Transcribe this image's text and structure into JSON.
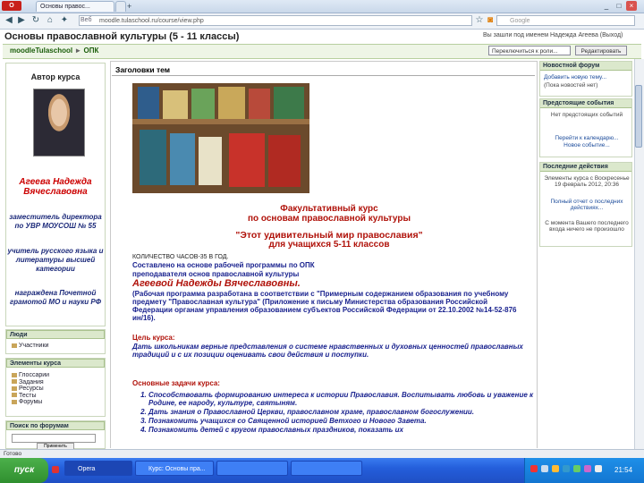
{
  "browser": {
    "tabs": [
      {
        "label": "Основы правос..."
      },
      {
        "label": "Курс: Основы пра..."
      }
    ],
    "new_tab_label": "+",
    "url_label": "Веб",
    "url_value": "moodle.tulaschool.ru/course/view.php",
    "search_placeholder": "Google",
    "window_controls": [
      "_",
      "□",
      "×"
    ]
  },
  "page": {
    "title": "Основы православной культуры (5 - 11 классы)",
    "login_info": "Вы зашли под именем Надежда Агеева (Выход)",
    "breadcrumb_root": "moodleTulaschool",
    "breadcrumb_sep": "►",
    "breadcrumb_course": "ОПК",
    "switch_role_select": "Переключиться к роли...",
    "edit_button": "Редактировать"
  },
  "left": {
    "author_header": "Автор курса",
    "author_name": "Агеева Надежда Вячеславовна",
    "author_lines": [
      "заместитель директора по УВР МОУСОШ № 55",
      "учитель русского языка и литературы высшей категории",
      "награждена Почетной грамотой МО и науки РФ"
    ],
    "people_header": "Люди",
    "people_items": [
      "Участники"
    ],
    "activities_header": "Элементы курса",
    "activities_items": [
      "Глоссарии",
      "Задания",
      "Ресурсы",
      "Тесты",
      "Форумы"
    ],
    "search_header": "Поиск по форумам",
    "search_button": "Применить"
  },
  "center": {
    "header": "Заголовки тем",
    "course_title_1": "Факультативный курс",
    "course_title_2": "по основам православной культуры",
    "course_title_3": "\"Этот удивительный мир православия\"",
    "course_title_4": "для учащихся 5-11 классов",
    "hours": "КОЛИЧЕСТВО ЧАСОВ-35 В ГОД.",
    "composed_1": "Составлено на основе рабочей программы по ОПК",
    "composed_2": "преподавателя основ православной культуры",
    "teacher_name": "Агеевой Надежды Вячеславовны.",
    "program_text": "(Рабочая программа разработана в соответствии с \"Примерным содержанием образования по учебному предмету \"Православная культура\" (Приложение к письму Министерства образования Российской Федерации органам управления образованием субъектов Российской Федерации от 22.10.2002 №14-52-876 ин/16).",
    "goal_header": "Цель курса:",
    "goal_text": "Дать школьникам верные представления о системе нравственных и духовных ценностей православных традиций и с их позиции оценивать свои действия и поступки.",
    "tasks_header": "Основные задачи курса:",
    "tasks": [
      "Способствовать формированию интереса к истории Православия. Воспитывать любовь и уважение к Родине, ее народу, культуре, святыням.",
      "Дать знания о Православной Церкви, православном храме, православном богослужении.",
      "Познакомить учащихся со Священной историей Ветхого и Нового Завета.",
      "Познакомить детей с кругом православных праздников, показать их"
    ]
  },
  "right": {
    "news_header": "Новостной форум",
    "news_text": "(Пока новостей нет)",
    "news_link": "Добавить новую тему...",
    "events_header": "Предстоящие события",
    "events_text": "Нет предстоящих событий",
    "events_link_1": "Перейти к календарю...",
    "events_link_2": "Новое событие...",
    "recent_header": "Последние действия",
    "recent_text_1": "Элементы курса с Воскресенье 19 февраль 2012, 20:36",
    "recent_text_2": "Полный отчет о последних действиях...",
    "recent_text_3": "С момента Вашего последнего входа ничего не произошло"
  },
  "status": {
    "text": "Готово"
  },
  "taskbar": {
    "start_label": "пуск",
    "tasks": [
      "Opera",
      "Курс: Основы пра...",
      "",
      ""
    ],
    "clock": "21:54"
  },
  "colors": {
    "accent_red": "#b0120a",
    "accent_blue": "#1a238f",
    "moodle_green": "#1a5d0a",
    "taskbar_blue": "#245edb"
  }
}
